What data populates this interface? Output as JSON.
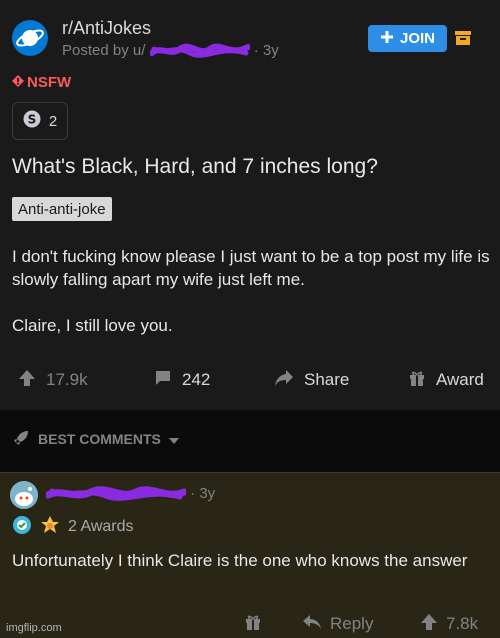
{
  "post": {
    "subreddit": "r/AntiJokes",
    "posted_by_prefix": "Posted by u/",
    "age": "· 3y",
    "join_label": "JOIN",
    "nsfw_label": "NSFW",
    "award_count": "2",
    "title": "What's Black, Hard, and 7 inches long?",
    "flair": "Anti-anti-joke",
    "body": [
      "I don't fucking know please I just want to be a top post my life is slowly falling apart my wife just left me.",
      "Claire, I still love you."
    ],
    "upvotes": "17.9k",
    "comments": "242",
    "share_label": "Share",
    "award_label": "Award"
  },
  "sort": {
    "label": "BEST COMMENTS"
  },
  "comment": {
    "age": "· 3y",
    "awards_label": "2 Awards",
    "text": "Unfortunately I think Claire is the one who knows the answer",
    "reply_label": "Reply",
    "upvotes": "7.8k"
  },
  "watermark": "imgflip.com",
  "colors": {
    "background": "#1a1a1b",
    "join": "#2e8ee6",
    "nsfw": "#ff585b",
    "highlight_comment": "#2a2616",
    "redaction": "#8a2be2"
  }
}
